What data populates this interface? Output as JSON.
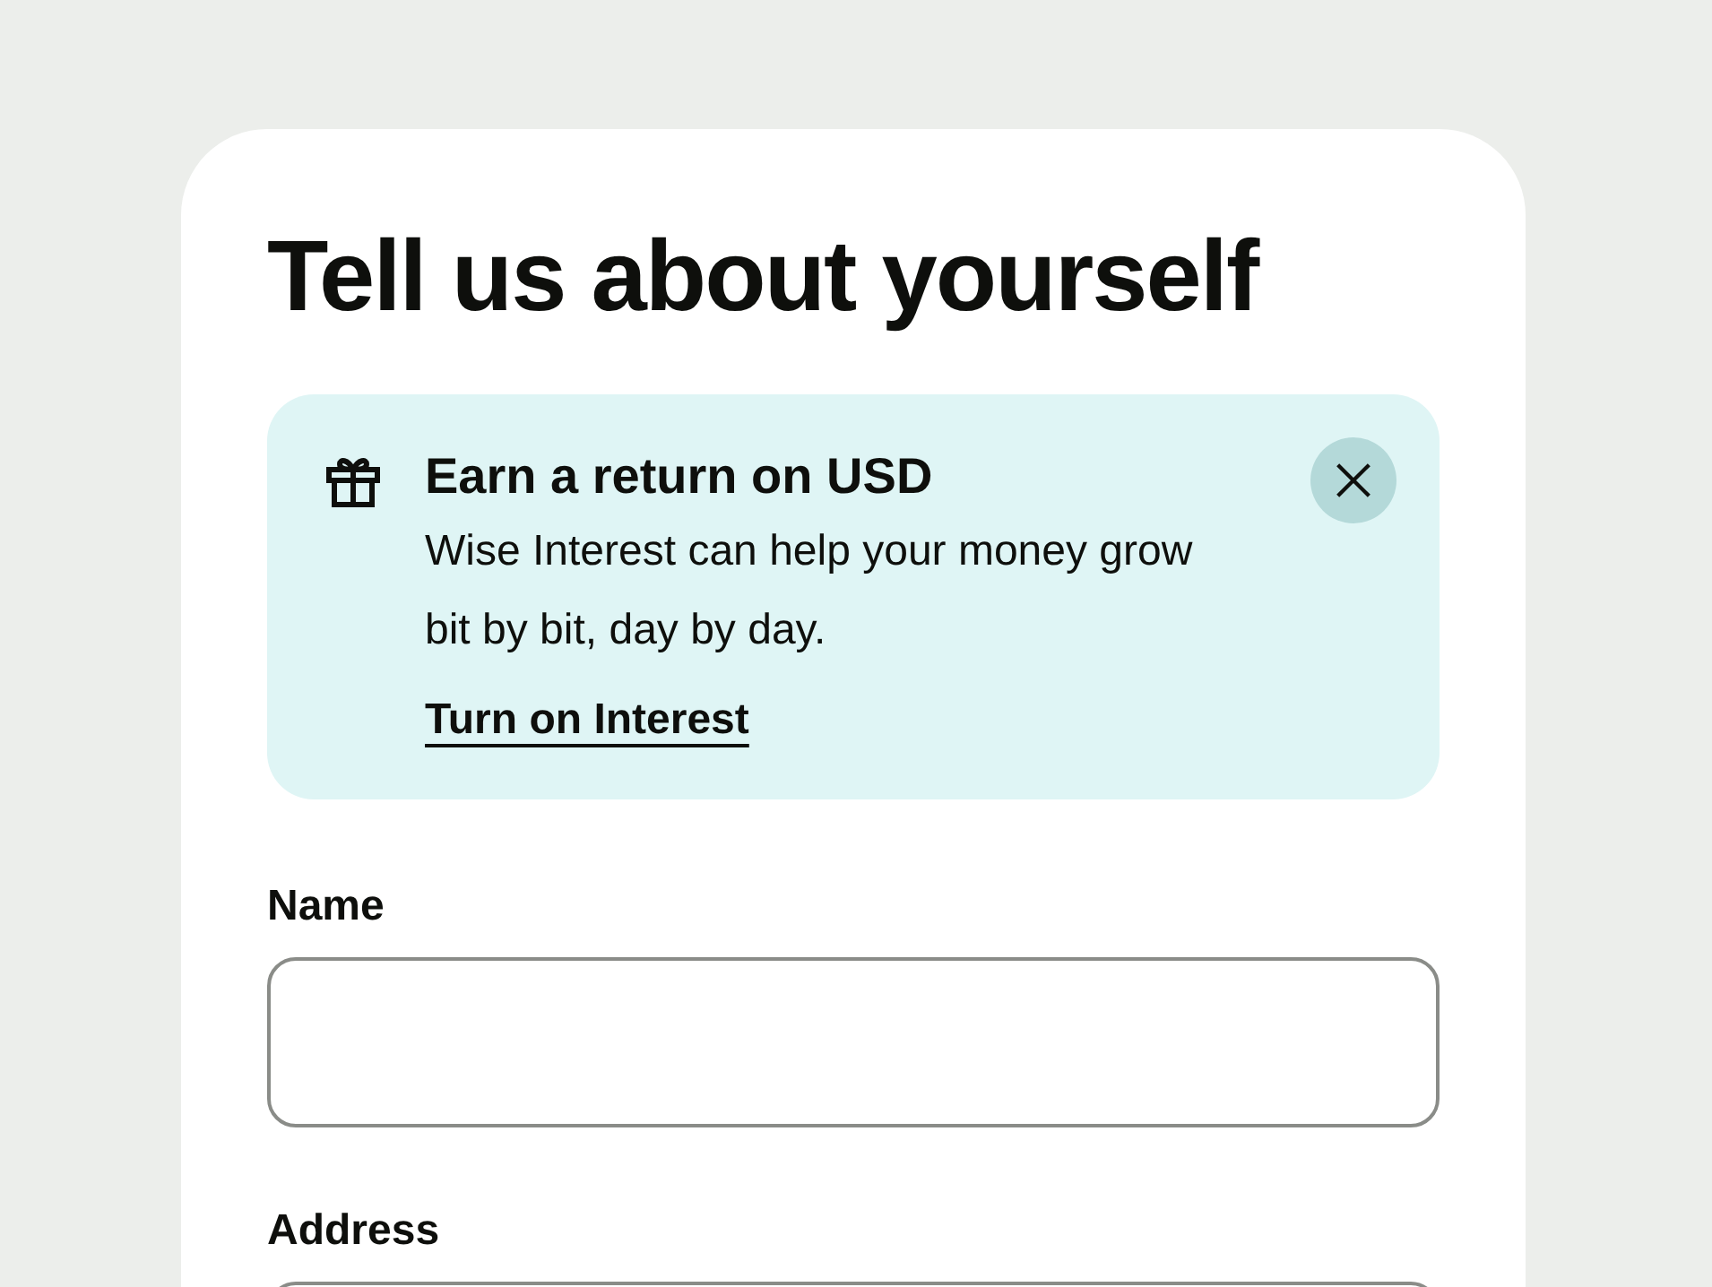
{
  "title": "Tell us about yourself",
  "alert": {
    "title": "Earn a return on USD",
    "body": "Wise Interest can help your money grow bit by bit, day by day.",
    "link": "Turn on Interest"
  },
  "fields": [
    {
      "label": "Name"
    },
    {
      "label": "Address"
    }
  ]
}
